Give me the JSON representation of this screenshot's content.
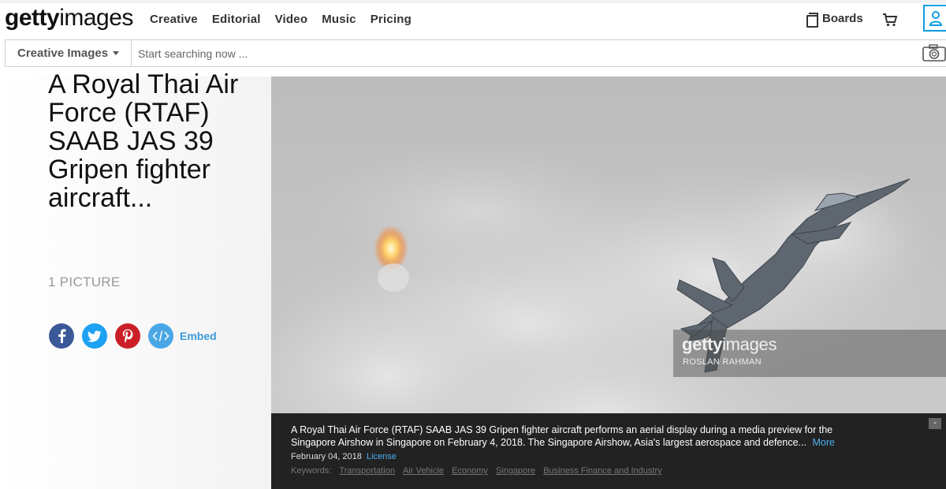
{
  "logo": {
    "bold": "getty",
    "light": "images"
  },
  "nav": {
    "creative": "Creative",
    "editorial": "Editorial",
    "video": "Video",
    "music": "Music",
    "pricing": "Pricing",
    "boards": "Boards"
  },
  "search": {
    "type": "Creative Images",
    "placeholder": "Start searching now ..."
  },
  "board": {
    "title": "A Royal Thai Air Force (RTAF) SAAB JAS 39 Gripen fighter aircraft...",
    "count": "1 PICTURE",
    "embed": "Embed"
  },
  "watermark": {
    "logo_bold": "getty",
    "logo_light": "images",
    "credit": "ROSLAN RAHMAN"
  },
  "caption": {
    "text": "A Royal Thai Air Force (RTAF) SAAB JAS 39 Gripen fighter aircraft performs an aerial display during a media preview for the Singapore Airshow in Singapore on February 4, 2018. The Singapore Airshow, Asia's largest aerospace and defence...",
    "more": "More",
    "date": "February 04, 2018",
    "license": "License",
    "keywords_label": "Keywords:",
    "keywords": [
      "Transportation",
      "Air Vehicle",
      "Economy",
      "Singapore",
      "Business Finance and Industry"
    ],
    "collapse": "-"
  },
  "colors": {
    "accent": "#0e9ee0",
    "link": "#4ab0f0",
    "facebook": "#3b5998",
    "twitter": "#1da1f2",
    "pinterest": "#cb2027"
  }
}
